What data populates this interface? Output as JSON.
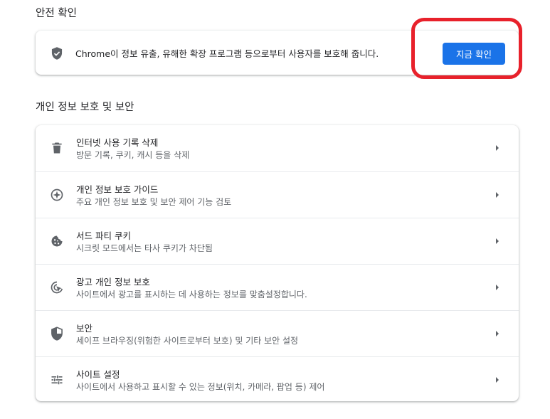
{
  "safety_check": {
    "section_title": "안전 확인",
    "description": "Chrome이 정보 유출, 유해한 확장 프로그램 등으로부터 사용자를 보호해 줍니다.",
    "button_label": "지금 확인"
  },
  "privacy": {
    "section_title": "개인 정보 보호 및 보안",
    "items": [
      {
        "title": "인터넷 사용 기록 삭제",
        "subtitle": "방문 기록, 쿠키, 캐시 등을 삭제",
        "icon": "trash-icon"
      },
      {
        "title": "개인 정보 보호 가이드",
        "subtitle": "주요 개인 정보 보호 및 보안 제어 기능 검토",
        "icon": "compass-icon"
      },
      {
        "title": "서드 파티 쿠키",
        "subtitle": "시크릿 모드에서는 타사 쿠키가 차단됨",
        "icon": "cookie-icon"
      },
      {
        "title": "광고 개인 정보 보호",
        "subtitle": "사이트에서 광고를 표시하는 데 사용하는 정보를 맞춤설정합니다.",
        "icon": "ad-privacy-icon"
      },
      {
        "title": "보안",
        "subtitle": "세이프 브라우징(위험한 사이트로부터 보호) 및 기타 보안 설정",
        "icon": "security-shield-icon"
      },
      {
        "title": "사이트 설정",
        "subtitle": "사이트에서 사용하고 표시할 수 있는 정보(위치, 카메라, 팝업 등) 제어",
        "icon": "sliders-icon"
      }
    ]
  },
  "colors": {
    "accent": "#1a73e8",
    "highlight": "#e8212b",
    "icon": "#5f6368"
  }
}
